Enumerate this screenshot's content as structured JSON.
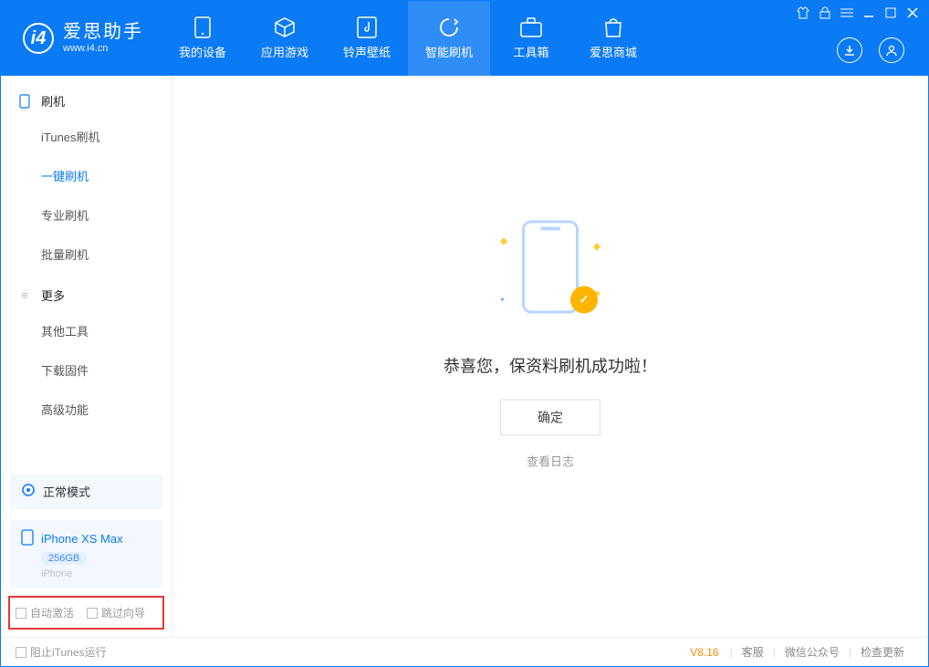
{
  "app": {
    "title": "爱思助手",
    "subtitle": "www.i4.cn"
  },
  "nav": {
    "items": [
      {
        "label": "我的设备"
      },
      {
        "label": "应用游戏"
      },
      {
        "label": "铃声壁纸"
      },
      {
        "label": "智能刷机"
      },
      {
        "label": "工具箱"
      },
      {
        "label": "爱思商城"
      }
    ]
  },
  "sidebar": {
    "section1": {
      "title": "刷机",
      "items": [
        "iTunes刷机",
        "一键刷机",
        "专业刷机",
        "批量刷机"
      ]
    },
    "section2": {
      "title": "更多",
      "items": [
        "其他工具",
        "下载固件",
        "高级功能"
      ]
    },
    "mode": {
      "label": "正常模式"
    },
    "device": {
      "name": "iPhone XS Max",
      "capacity": "256GB",
      "type": "iPhone"
    },
    "options": {
      "auto_activate": "自动激活",
      "skip_guide": "跳过向导"
    }
  },
  "main": {
    "success": "恭喜您，保资料刷机成功啦！",
    "ok": "确定",
    "view_log": "查看日志"
  },
  "footer": {
    "block_itunes": "阻止iTunes运行",
    "version": "V8.16",
    "links": [
      "客服",
      "微信公众号",
      "检查更新"
    ]
  }
}
